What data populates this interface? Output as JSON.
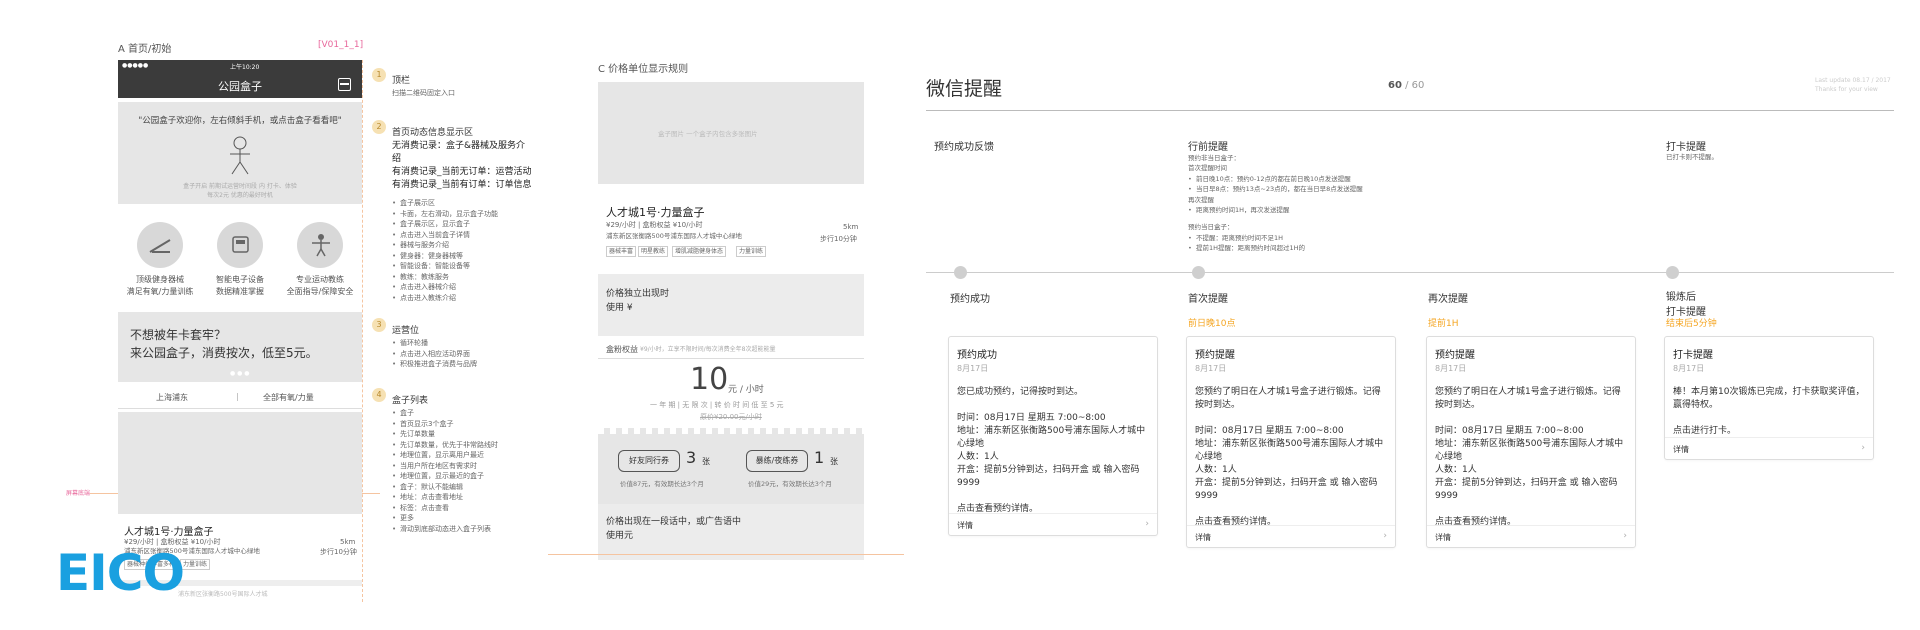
{
  "panel_a": {
    "title": "A 首页/初始",
    "version": "[V01_1_1]",
    "phone": {
      "status_dots": "●●●●● ",
      "status_time": "上午10:20",
      "app_title": "公园盒子",
      "banner_quote": "\"公园盒子欢迎你，左右倾斜手机，或点击盒子看看吧\"",
      "banner_caption_1": "盒子开启  前期试运营时间段  内  打卡、体验",
      "banner_caption_2": "每次2元  优惠的最好时机",
      "features": [
        {
          "line1": "顶级健身器械",
          "line2": "满足有氧/力量训练"
        },
        {
          "line1": "智能电子设备",
          "line2": "数据精准掌握"
        },
        {
          "line1": "专业运动教练",
          "line2": "全面指导/保障安全"
        }
      ],
      "promo_line1": "不想被年卡套牢？",
      "promo_line2": "来公园盒子，消费按次，低至5元。",
      "filter_left": "上海浦东",
      "filter_right": "全部有氧/力量",
      "list_item_title": "人才城1号·力量盒子",
      "list_item_price": "¥29/小时 | 盒粉权益 ¥10/小时",
      "list_item_addr": "浦东新区张衡路500号浦东国际人才城中心绿地",
      "list_item_dist": "5km",
      "list_item_walk": "步行10分钟",
      "list_item_tags": [
        "器械种类丰富多样",
        "力量训练"
      ],
      "list_item2_text": "浦东新区张衡路500号国际人才城"
    },
    "side_marker": "屏幕底端",
    "annotations": [
      {
        "num": "1",
        "title": "顶栏",
        "desc": "扫描二维码固定入口"
      },
      {
        "num": "2",
        "title": "首页动态信息显示区",
        "lines": [
          "无消费记录：盒子&器械及服务介绍",
          "有消费记录_当前无订单：运营活动",
          "有消费记录_当前有订单：订单信息"
        ]
      },
      {
        "num": "3",
        "title": "运营位",
        "lines": [
          "循环轮播",
          "点击进入相应活动界面",
          "后期需要放置盒粉权益"
        ]
      },
      {
        "num": "4",
        "title": "盒子列表",
        "lines": [
          "首页显示3个盒子",
          "先订单数量，优先于非常路线时",
          "地理位置，显示离用户最近",
          "当用户所在地区有需求时",
          "地理位置，显示最近的盒子"
        ]
      }
    ],
    "annot_2_detail": [
      "盒子展示区",
      "卡面，左右滑动，显示盒子功能",
      "盒子展示区，显示盒子",
      "点击进入当前盒子详情",
      "器械与服务介绍",
      "健身器：健身器械等",
      "智能设备：智能设备等",
      "教练：教练服务",
      "点击进入器械介绍",
      "点击进入教练介绍"
    ],
    "annot_3_detail": [
      "循环轮播",
      "点击进入相应活动界面",
      "积极推进盒子消费与品牌"
    ],
    "annot_4_detail": [
      "盒子",
      "首页显示3个盒子",
      "先订单数量",
      "盒子：默认不能编辑",
      "地址：点击查看地址",
      "标签：点击查看",
      "更多",
      "滑动到底部动态进入盒子列表"
    ]
  },
  "panel_c": {
    "title": "C 价格单位显示规则",
    "image_caption": "盒子图片  一个盒子内包含多张图片",
    "store_title": "人才城1号·力量盒子",
    "store_price": "¥29/小时 | 盒粉权益 ¥10/小时",
    "store_dist": "5km",
    "store_addr": "浦东新区张衡路500号浦东国际人才城中心绿地",
    "store_walk": "步行10分钟",
    "store_tags": [
      "器械丰富",
      "明星教练",
      "增肌减脂健身体态",
      "力量训练"
    ],
    "note1_line1": "价格独立出现时",
    "note1_line2": "使用 ¥",
    "member_label": "盒粉权益",
    "member_sub": "¥9/小时，立享不限时间/每次消费全年8次超能能量",
    "big_price": "10",
    "big_unit": "元 / 小时",
    "price_sub1": "一 年 期  |  无 限 次  |  转 价 时 间 低 至 5 元",
    "price_sub2": "原价¥20.00元/小时",
    "coupon1_name": "好友同行券",
    "coupon1_count": "3",
    "coupon1_unit": "张",
    "coupon1_sub": "价值87元，有效期长达3个月",
    "coupon2_name": "暴练/夜练券",
    "coupon2_count": "1",
    "coupon2_unit": "张",
    "coupon2_sub": "价值29元，有效期长达3个月",
    "note2_line1": "价格出现在一段话中，或广告语中",
    "note2_line2": "使用元"
  },
  "panel_wechat": {
    "title": "微信提醒",
    "page_current": "60",
    "page_sep": " / ",
    "page_total": "60",
    "update_line1": "Last update 08.17 / 2017",
    "update_line2": "Thanks for your view",
    "section_feedback": "预约成功反馈",
    "section_before": "行前提醒",
    "before_lines": [
      "预约非当日盒子：",
      "首次提醒时间",
      "前日晚10点：预约0-12点的都在前日晚10点发送提醒",
      "当日早8点：预约13点~23点的，都在当日早8点发送提醒",
      "再次提醒",
      "距离预约时间1H，再次发送提醒",
      "",
      "预约当日盒子：",
      "不提醒：距离预约时间不足1H",
      "提前1H提醒：距离预约时间超过1H的"
    ],
    "section_checkin": "打卡提醒",
    "checkin_desc": "已打卡则不提醒。",
    "columns": [
      {
        "label": "预约成功",
        "sub": ""
      },
      {
        "label": "首次提醒",
        "sub": "前日晚10点"
      },
      {
        "label": "再次提醒",
        "sub": "提前1H"
      },
      {
        "label": "锻炼后\n打卡提醒",
        "sub": "结束后5分钟"
      }
    ],
    "cards": [
      {
        "title": "预约成功",
        "date": "8月17日",
        "body": "您已成功预约，记得按时到达。\n\n时间：08月17日 星期五 7:00~8:00\n地址：浦东新区张衡路500号浦东国际人才城中心绿地\n人数：1人\n开盒：提前5分钟到达，扫码开盒 或 输入密码9999\n\n点击查看预约详情。",
        "foot": "详情"
      },
      {
        "title": "预约提醒",
        "date": "8月17日",
        "body": "您预约了明日在人才城1号盒子进行锻炼。记得按时到达。\n\n时间：08月17日 星期五 7:00~8:00\n地址：浦东新区张衡路500号浦东国际人才城中心绿地\n人数：1人\n开盒：提前5分钟到达，扫码开盒 或 输入密码9999\n\n点击查看预约详情。",
        "foot": "详情"
      },
      {
        "title": "预约提醒",
        "date": "8月17日",
        "body": "您预约了明日在人才城1号盒子进行锻炼。记得按时到达。\n\n时间：08月17日 星期五 7:00~8:00\n地址：浦东新区张衡路500号浦东国际人才城中心绿地\n人数：1人\n开盒：提前5分钟到达，扫码开盒 或 输入密码9999\n\n点击查看预约详情。",
        "foot": "详情"
      },
      {
        "title": "打卡提醒",
        "date": "8月17日",
        "body": "棒！本月第10次锻炼已完成，打卡获取奖评值，赢得特权。\n\n点击进行打卡。",
        "foot": "详情"
      }
    ]
  },
  "logo": "EICO",
  "colors": {
    "accent_orange": "#f5a623",
    "logo_blue": "#1aa0e0",
    "annot_pink": "#e8679b"
  }
}
